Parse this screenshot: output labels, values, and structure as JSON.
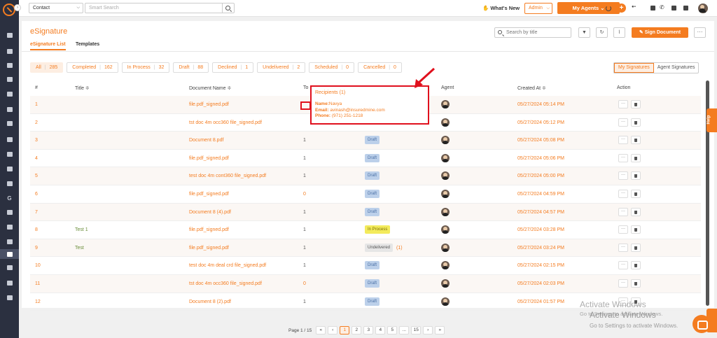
{
  "topbar": {
    "module_select": "Contact",
    "search_placeholder": "Smart Search",
    "whats_new": "What's New",
    "role_select": "Admin",
    "my_agents": "My Agents"
  },
  "page": {
    "title": "eSignature",
    "tabs": [
      "eSignature List",
      "Templates"
    ],
    "search_placeholder": "Search by title",
    "sign_button": "Sign Document"
  },
  "filters": [
    {
      "label": "All",
      "count": "285"
    },
    {
      "label": "Completed",
      "count": "162"
    },
    {
      "label": "In Process",
      "count": "32"
    },
    {
      "label": "Draft",
      "count": "88"
    },
    {
      "label": "Declined",
      "count": "1"
    },
    {
      "label": "Undelivered",
      "count": "2"
    },
    {
      "label": "Scheduled",
      "count": "0"
    },
    {
      "label": "Cancelled",
      "count": "0"
    }
  ],
  "sig_toggle": [
    "My Signatures",
    "Agent Signatures"
  ],
  "columns": [
    "#",
    "Title ≑",
    "Document Name ≑",
    "To",
    "Agent",
    "Created At ≑",
    "Action"
  ],
  "rows": [
    {
      "num": "1",
      "title": "",
      "doc": "file.pdf_signed.pdf",
      "to": "",
      "status": "",
      "created": "05/27/2024 05:14 PM"
    },
    {
      "num": "2",
      "title": "",
      "doc": "tst doc 4m occ360 file_signed.pdf",
      "to": "",
      "status": "",
      "created": "05/27/2024 05:12 PM"
    },
    {
      "num": "3",
      "title": "",
      "doc": "Document 8.pdf",
      "to": "1",
      "status": "Draft",
      "created": "05/27/2024 05:08 PM"
    },
    {
      "num": "4",
      "title": "",
      "doc": "file.pdf_signed.pdf",
      "to": "1",
      "status": "Draft",
      "created": "05/27/2024 05:06 PM"
    },
    {
      "num": "5",
      "title": "",
      "doc": "test doc 4m cont360 file_signed.pdf",
      "to": "1",
      "status": "Draft",
      "created": "05/27/2024 05:00 PM"
    },
    {
      "num": "6",
      "title": "",
      "doc": "file.pdf_signed.pdf",
      "to": "0",
      "status": "Draft",
      "created": "05/27/2024 04:59 PM"
    },
    {
      "num": "7",
      "title": "",
      "doc": "Document 8 (4).pdf",
      "to": "1",
      "status": "Draft",
      "created": "05/27/2024 04:57 PM"
    },
    {
      "num": "8",
      "title": "Test 1",
      "doc": "file.pdf_signed.pdf",
      "to": "1",
      "status": "In Process",
      "created": "05/27/2024 03:28 PM"
    },
    {
      "num": "9",
      "title": "Test",
      "doc": "file.pdf_signed.pdf",
      "to": "1",
      "status": "Undelivered",
      "status_count": "(1)",
      "created": "05/27/2024 03:24 PM"
    },
    {
      "num": "10",
      "title": "",
      "doc": "test doc 4m deal crd file_signed.pdf",
      "to": "1",
      "status": "Draft",
      "created": "05/27/2024 02:15 PM"
    },
    {
      "num": "11",
      "title": "",
      "doc": "tst doc 4m occ360 file_signed.pdf",
      "to": "0",
      "status": "Draft",
      "created": "05/27/2024 02:03 PM"
    },
    {
      "num": "12",
      "title": "",
      "doc": "Document 8 (2).pdf",
      "to": "1",
      "status": "Draft",
      "created": "05/27/2024 01:57 PM"
    }
  ],
  "popup": {
    "header": "Recipients (1)",
    "name_label": "Name:",
    "name": "Navya",
    "email_label": "Email:",
    "email": "avinash@insuredmine.com",
    "phone_label": "Phone:",
    "phone": "(971) 251-1218"
  },
  "pagination": {
    "label": "Page 1 / 15",
    "pages": [
      "1",
      "2",
      "3",
      "4",
      "5",
      "...",
      "15"
    ]
  },
  "help_tab": "Help",
  "watermark": {
    "line1": "Activate Windows",
    "line2": "Go to Settings to activate Windows."
  },
  "colors": {
    "accent": "#f47c20",
    "sidebar": "#2b3040",
    "highlight": "#e0101d"
  }
}
